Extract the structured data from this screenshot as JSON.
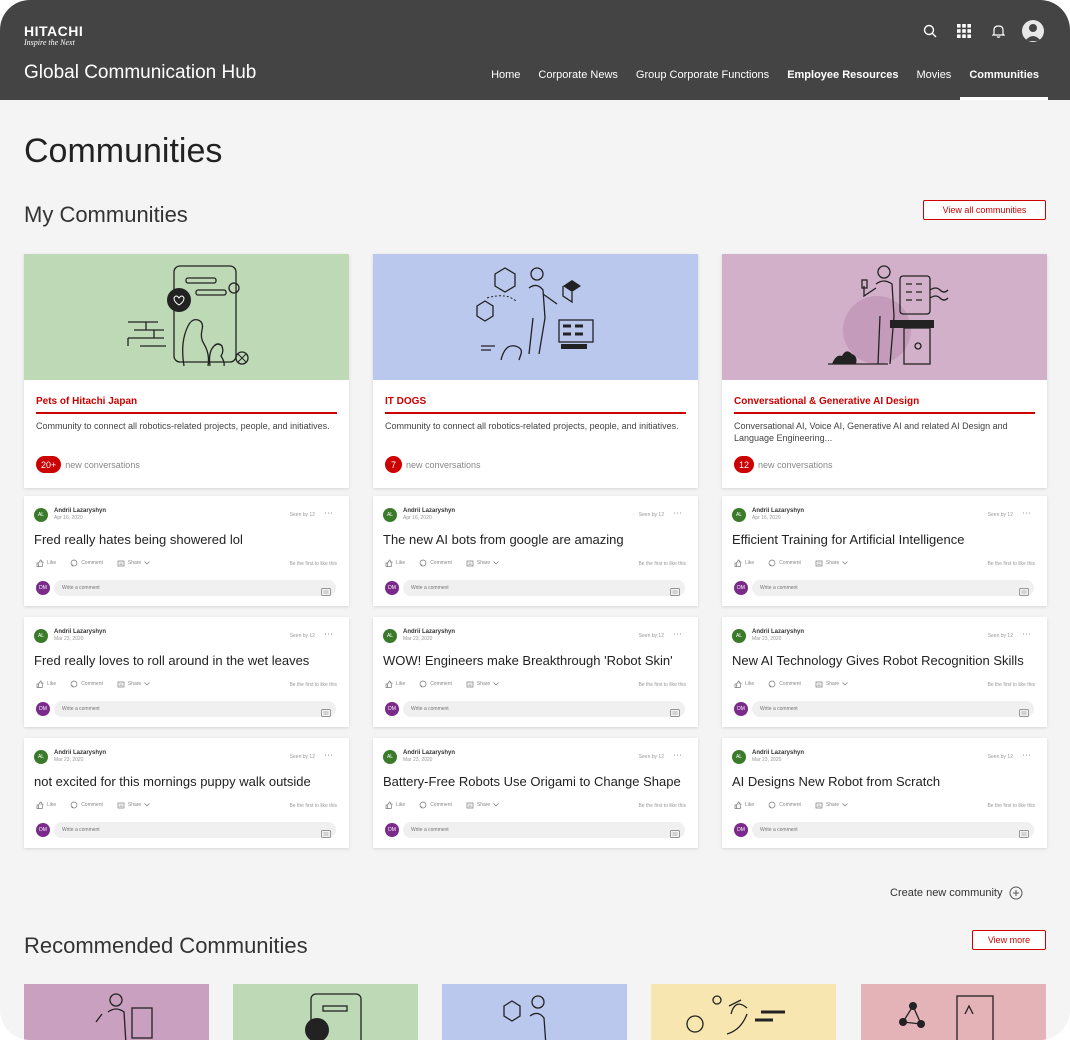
{
  "brand": {
    "name": "HITACHI",
    "tagline": "Inspire the Next"
  },
  "site_title": "Global Communication Hub",
  "nav": [
    {
      "label": "Home",
      "bold": false,
      "active": false
    },
    {
      "label": "Corporate News",
      "bold": false,
      "active": false
    },
    {
      "label": "Group Corporate Functions",
      "bold": false,
      "active": false
    },
    {
      "label": "Employee Resources",
      "bold": true,
      "active": false
    },
    {
      "label": "Movies",
      "bold": false,
      "active": false
    },
    {
      "label": "Communities",
      "bold": true,
      "active": true
    }
  ],
  "top_icons": [
    "search-icon",
    "apps-grid-icon",
    "bell-icon",
    "user-avatar"
  ],
  "page_title": "Communities",
  "my_communities": {
    "title": "My Communities",
    "view_all_label": "View all communities",
    "cards": [
      {
        "name": "Pets of Hitachi Japan",
        "desc": "Community to connect all robotics-related projects, people, and initiatives.",
        "badge": "20+",
        "conv_label": "new conversations",
        "bg": "#bdd9b6",
        "illus": "pets"
      },
      {
        "name": "IT DOGS",
        "desc": "Community to connect all robotics-related projects, people, and initiatives.",
        "badge": "7",
        "conv_label": "new conversations",
        "bg": "#bac8ee",
        "illus": "dogs"
      },
      {
        "name": "Conversational & Generative AI Design",
        "desc": "Conversational AI, Voice AI, Generative AI and related AI Design and Language Engineering...",
        "badge": "12",
        "conv_label": "new conversations",
        "bg": "#d3b0ca",
        "illus": "ai"
      }
    ]
  },
  "post_common": {
    "author": "Andrii Lazaryshyn",
    "author_initials": "AL",
    "commenter_initials": "DM",
    "like": "Like",
    "comment": "Comment",
    "share": "Share",
    "seen": "Seen by 12",
    "first_like": "Be the first to like this",
    "comment_placeholder": "Write a comment"
  },
  "posts": [
    [
      {
        "date": "Apr 16, 2020",
        "text": "Fred really hates being showered lol"
      },
      {
        "date": "Mar 23, 2020",
        "text": "Fred really loves to roll around in the wet leaves"
      },
      {
        "date": "Mar 23, 2020",
        "text": "not excited for this mornings puppy walk outside"
      }
    ],
    [
      {
        "date": "Apr 16, 2020",
        "text": "The new AI bots from google are amazing"
      },
      {
        "date": "Mar 23, 2020",
        "text": "WOW! Engineers make Breakthrough 'Robot Skin'"
      },
      {
        "date": "Mar 23, 2020",
        "text": "Battery-Free Robots Use Origami to Change Shape"
      }
    ],
    [
      {
        "date": "Apr 16, 2020",
        "text": "Efficient Training for Artificial Intelligence"
      },
      {
        "date": "Mar 23, 2020",
        "text": "New AI Technology Gives Robot Recognition Skills"
      },
      {
        "date": "Mar 23, 2020",
        "text": "AI Designs New Robot from Scratch"
      }
    ]
  ],
  "create_label": "Create new community",
  "recommended": {
    "title": "Recommended Communities",
    "view_more_label": "View more",
    "cards": [
      {
        "bg": "#c9a0c0"
      },
      {
        "bg": "#bdd9b6"
      },
      {
        "bg": "#bac8ee"
      },
      {
        "bg": "#f8e6b0"
      },
      {
        "bg": "#e3b3b8"
      }
    ]
  },
  "colors": {
    "accent": "#cc0000",
    "header": "#444444",
    "page_bg": "#f4f4f4"
  }
}
